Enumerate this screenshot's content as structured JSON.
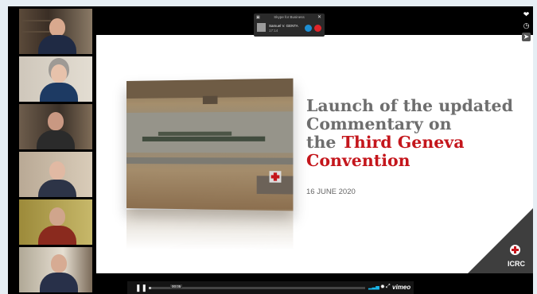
{
  "skype": {
    "app_name": "Skype for Business",
    "caller": "Samuel V. GENTA",
    "call_time": "17:14"
  },
  "slide": {
    "title_line1": "Launch of the updated",
    "title_line2": "Commentary on",
    "title_line3_plain": "the ",
    "title_line3_red": "Third Geneva",
    "title_line4_red": "Convention",
    "date": "16 JUNE 2020",
    "logo_text": "ICRC"
  },
  "player": {
    "time_badge": "00:05",
    "brand": "vimeo",
    "progress": 0.01,
    "icons": {
      "pause": "pause-icon",
      "volume": "volume-icon",
      "settings": "settings-icon",
      "fullscreen": "fullscreen-icon",
      "like": "heart-icon",
      "watch_later": "clock-icon",
      "share": "share-icon"
    }
  },
  "colors": {
    "accent_red": "#c4161c",
    "title_grey": "#6e6e6e",
    "vimeo_blue": "#1ab7ea"
  }
}
